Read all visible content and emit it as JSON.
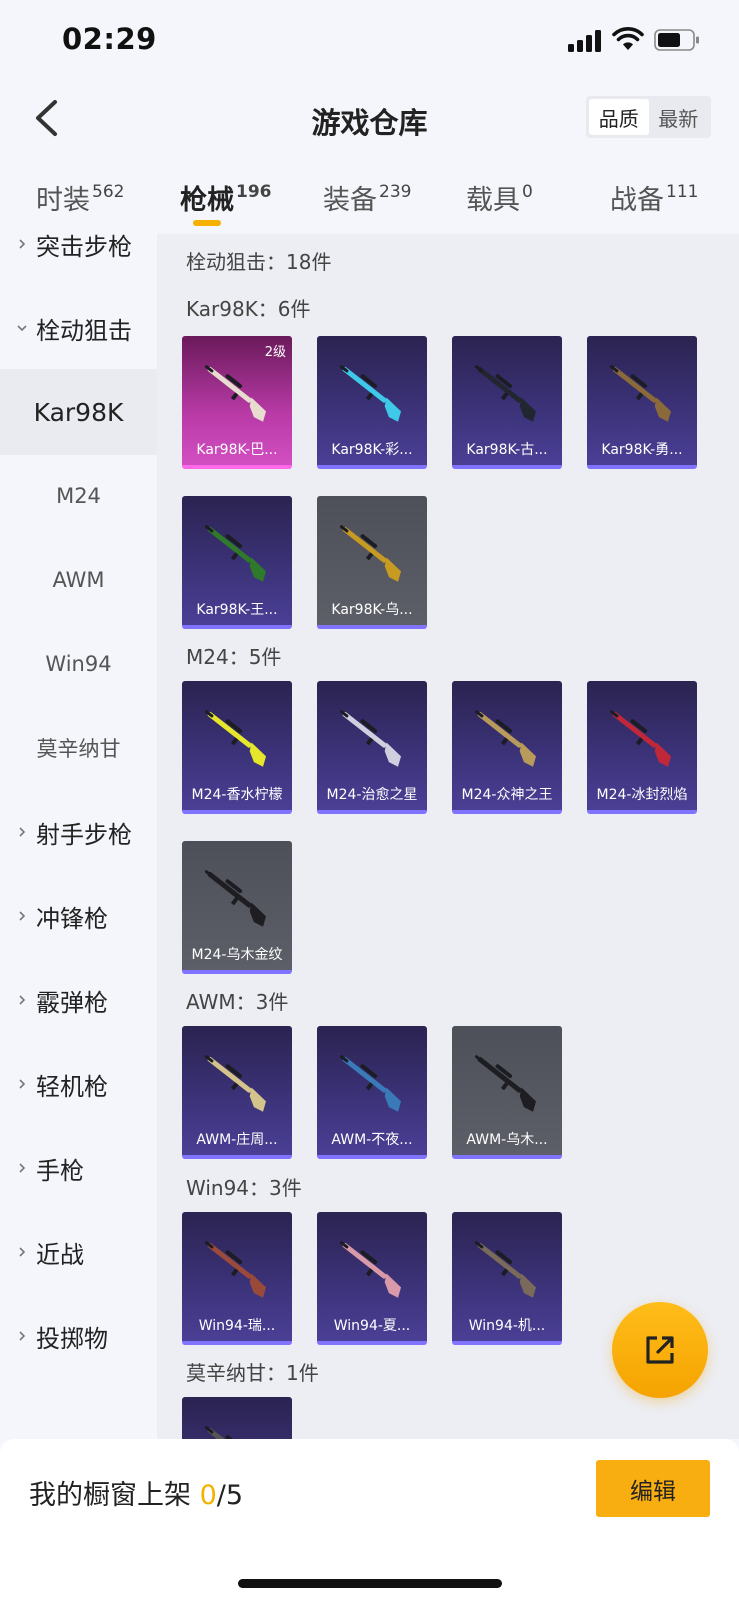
{
  "status": {
    "time": "02:29"
  },
  "header": {
    "title": "游戏仓库",
    "sort_quality": "品质",
    "sort_newest": "最新"
  },
  "tabs": [
    {
      "label": "时装",
      "count": "562"
    },
    {
      "label": "枪械",
      "count": "196"
    },
    {
      "label": "装备",
      "count": "239"
    },
    {
      "label": "载具",
      "count": "0"
    },
    {
      "label": "战备",
      "count": "111"
    }
  ],
  "sidebar": {
    "items": [
      {
        "label": "突击步枪",
        "kind": "category"
      },
      {
        "label": "栓动狙击",
        "kind": "category-open"
      },
      {
        "label": "Kar98K",
        "kind": "sub-selected"
      },
      {
        "label": "M24",
        "kind": "sub"
      },
      {
        "label": "AWM",
        "kind": "sub"
      },
      {
        "label": "Win94",
        "kind": "sub"
      },
      {
        "label": "莫辛纳甘",
        "kind": "sub"
      },
      {
        "label": "射手步枪",
        "kind": "category"
      },
      {
        "label": "冲锋枪",
        "kind": "category"
      },
      {
        "label": "霰弹枪",
        "kind": "category"
      },
      {
        "label": "轻机枪",
        "kind": "category"
      },
      {
        "label": "手枪",
        "kind": "category"
      },
      {
        "label": "近战",
        "kind": "category"
      },
      {
        "label": "投掷物",
        "kind": "category"
      }
    ]
  },
  "content": {
    "summary": "栓动狙击：18件",
    "sections": [
      {
        "label": "Kar98K：6件",
        "cards": [
          {
            "name": "Kar98K-巴...",
            "rarity": "pink",
            "level": "2级",
            "gun_color": "#e8dcd0"
          },
          {
            "name": "Kar98K-彩...",
            "rarity": "purple",
            "gun_color": "#3fc9e8"
          },
          {
            "name": "Kar98K-古...",
            "rarity": "purple",
            "gun_color": "#222630"
          },
          {
            "name": "Kar98K-勇...",
            "rarity": "purple",
            "gun_color": "#8a6a3a"
          },
          {
            "name": "Kar98K-王...",
            "rarity": "purple",
            "gun_color": "#2f7a2a"
          },
          {
            "name": "Kar98K-乌...",
            "rarity": "gray",
            "gun_color": "#c79a22"
          }
        ]
      },
      {
        "label": "M24：5件",
        "cards": [
          {
            "name": "M24-香水柠檬",
            "rarity": "purple",
            "gun_color": "#e6e62a"
          },
          {
            "name": "M24-治愈之星",
            "rarity": "purple",
            "gun_color": "#cfcfe0"
          },
          {
            "name": "M24-众神之王",
            "rarity": "purple",
            "gun_color": "#b89a5a"
          },
          {
            "name": "M24-冰封烈焰",
            "rarity": "purple",
            "gun_color": "#c0283a"
          },
          {
            "name": "M24-乌木金纹",
            "rarity": "gray",
            "gun_color": "#1e1e22"
          }
        ]
      },
      {
        "label": "AWM：3件",
        "cards": [
          {
            "name": "AWM-庄周...",
            "rarity": "purple",
            "gun_color": "#d4c38a"
          },
          {
            "name": "AWM-不夜...",
            "rarity": "purple",
            "gun_color": "#3a7ab8"
          },
          {
            "name": "AWM-乌木...",
            "rarity": "gray",
            "gun_color": "#1e1e22"
          }
        ]
      },
      {
        "label": "Win94：3件",
        "cards": [
          {
            "name": "Win94-瑞...",
            "rarity": "purple",
            "gun_color": "#9a4a3a"
          },
          {
            "name": "Win94-夏...",
            "rarity": "purple",
            "gun_color": "#d89aa8"
          },
          {
            "name": "Win94-机...",
            "rarity": "purple",
            "gun_color": "#7a6a5a"
          }
        ]
      },
      {
        "label": "莫辛纳甘：1件",
        "cards": [
          {
            "name": "",
            "rarity": "purple",
            "gun_color": "#555"
          }
        ]
      }
    ]
  },
  "bottom": {
    "showcase_label": "我的橱窗上架 ",
    "showcase_count": "0",
    "showcase_total": "/5",
    "edit_label": "编辑"
  },
  "colors": {
    "accent": "#f5b000",
    "rare_purple": "#7f73ff",
    "rare_pink": "#d24fc2"
  }
}
